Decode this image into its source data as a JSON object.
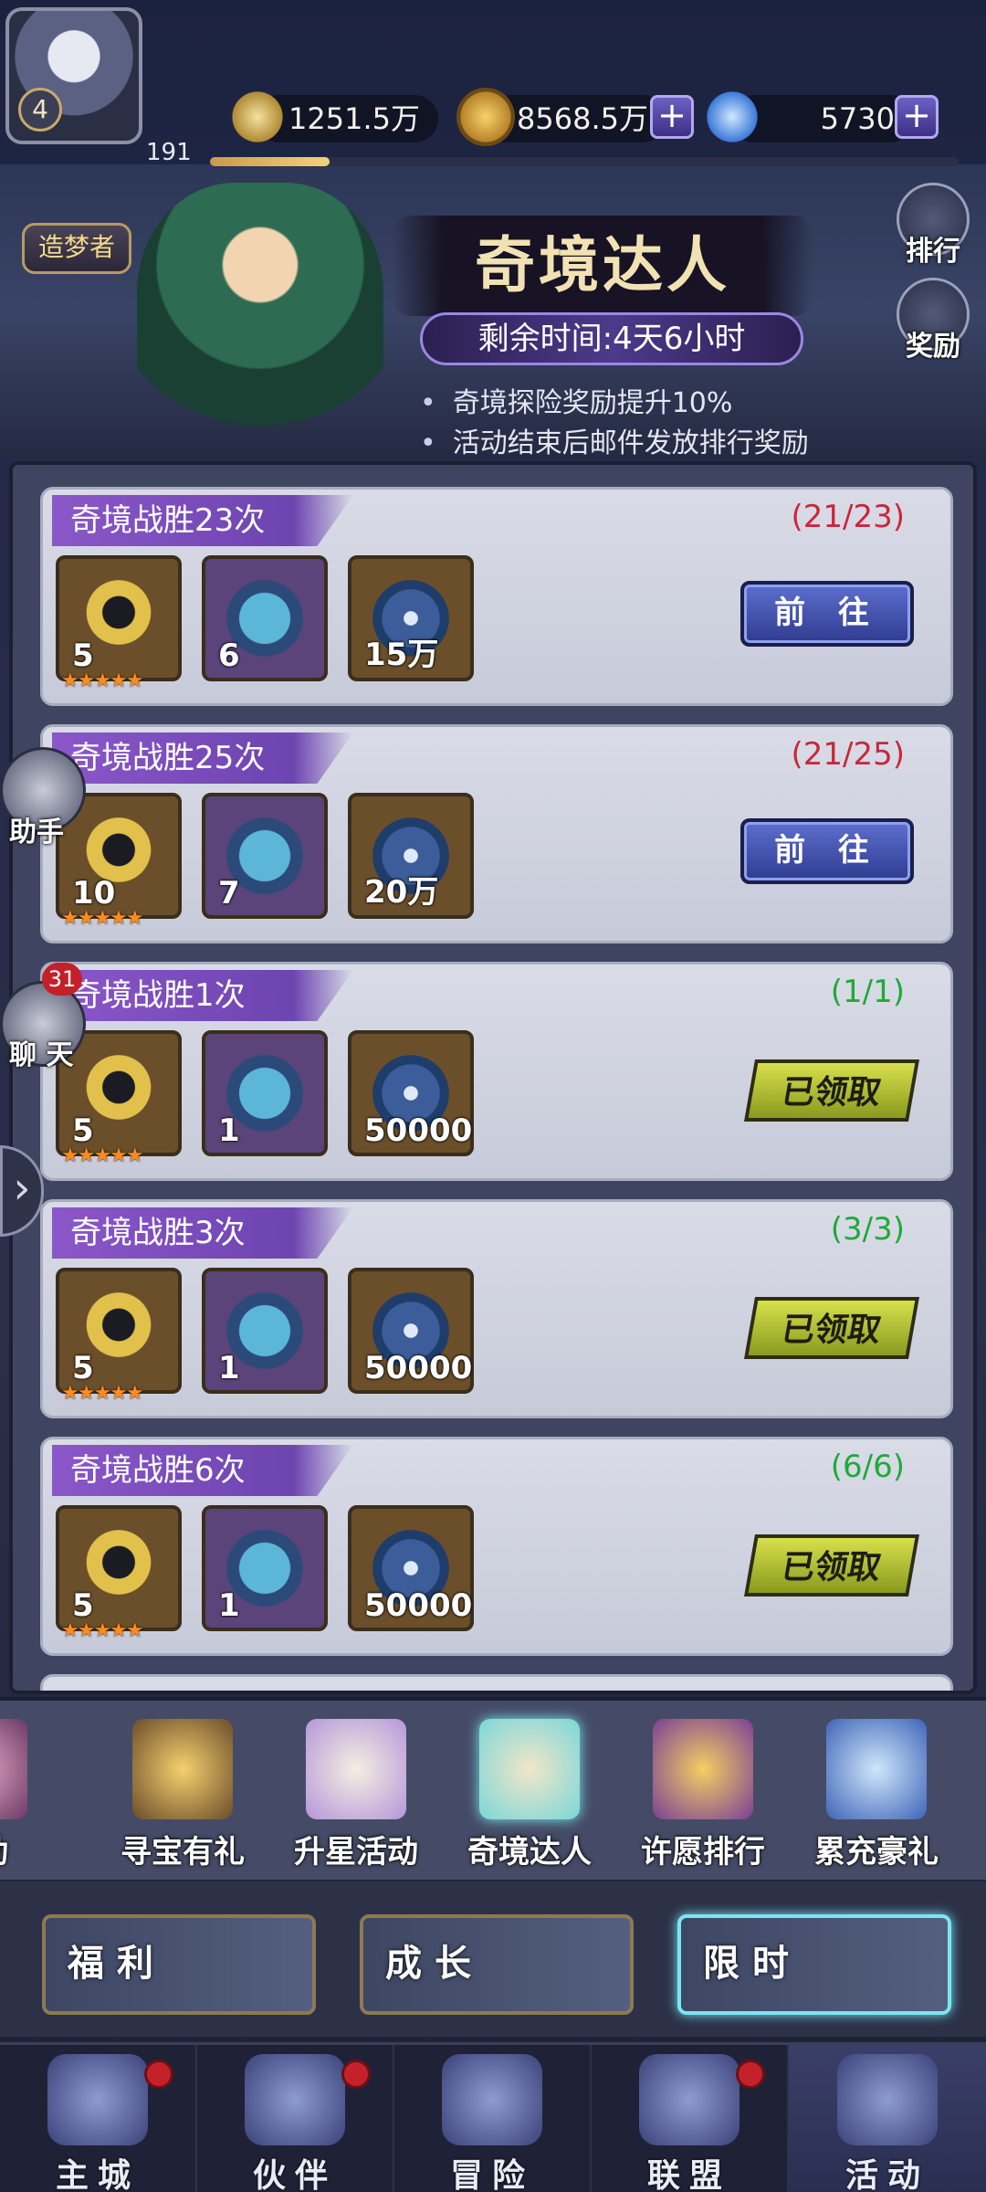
{
  "player": {
    "level": "4",
    "exp_value": "191",
    "title": "造梦者"
  },
  "resources": {
    "power": "1251.5万",
    "gold": "8568.5万",
    "diamond": "5730"
  },
  "banner": {
    "title": "奇境达人",
    "time_left": "剩余时间:4天6小时",
    "note1": "奇境探险奖励提升10%",
    "note2": "活动结束后邮件发放排行奖励",
    "rank_label": "排行",
    "reward_label": "奖励"
  },
  "floating": {
    "assistant_label": "助手",
    "chat_label": "聊 天",
    "chat_badge": "31"
  },
  "tasks": [
    {
      "title": "奇境战胜23次",
      "progress": "(21/23)",
      "rewards": [
        "5",
        "6",
        "15万"
      ],
      "action": "前 往"
    },
    {
      "title": "奇境战胜25次",
      "progress": "(21/25)",
      "rewards": [
        "10",
        "7",
        "20万"
      ],
      "action": "前 往"
    },
    {
      "title": "奇境战胜1次",
      "progress": "(1/1)",
      "rewards": [
        "5",
        "1",
        "50000"
      ],
      "action": "已领取"
    },
    {
      "title": "奇境战胜3次",
      "progress": "(3/3)",
      "rewards": [
        "5",
        "1",
        "50000"
      ],
      "action": "已领取"
    },
    {
      "title": "奇境战胜6次",
      "progress": "(6/6)",
      "rewards": [
        "5",
        "1",
        "50000"
      ],
      "action": "已领取"
    }
  ],
  "activity_tabs": [
    "活动",
    "寻宝有礼",
    "升星活动",
    "奇境达人",
    "许愿排行",
    "累充豪礼"
  ],
  "categories": [
    "福利",
    "成长",
    "限时"
  ],
  "nav": [
    "主城",
    "伙伴",
    "冒险",
    "联盟",
    "活动"
  ],
  "colors": {
    "progress_incomplete": "#c8283a",
    "progress_complete": "#1faa3a",
    "task_title_bg": "#8b57c9"
  },
  "exp_progress": 0.16
}
